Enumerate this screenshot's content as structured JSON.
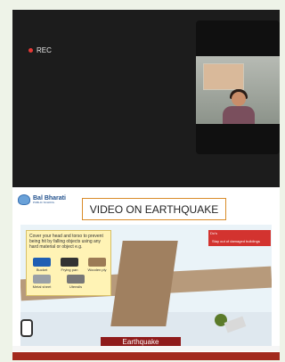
{
  "call": {
    "rec_label": "REC"
  },
  "slide": {
    "logo_name": "Bal Bharati",
    "logo_subtitle": "PUBLIC SCHOOL",
    "title": "VIDEO ON EARTHQUAKE",
    "tips_text": "Cover your head and torso to prevent being hit by falling objects using any hard material or object e.g.",
    "items": [
      {
        "label": "Bucket",
        "icon": "bucket-icon"
      },
      {
        "label": "Frying pan",
        "icon": "frying-pan-icon"
      },
      {
        "label": "Wooden ply",
        "icon": "wooden-ply-icon"
      },
      {
        "label": "Metal sheet",
        "icon": "metal-sheet-icon"
      },
      {
        "label": "Utensils",
        "icon": "utensils-icon"
      }
    ],
    "dos_title": "Do's",
    "dos_text": "Stay out of damaged buildings",
    "banner_text": "Earthquake"
  },
  "colors": {
    "rec_dot": "#e53935",
    "title_border": "#d98c2a",
    "dos_bg": "#d3332f",
    "banner_bg": "#8f1b1b"
  }
}
